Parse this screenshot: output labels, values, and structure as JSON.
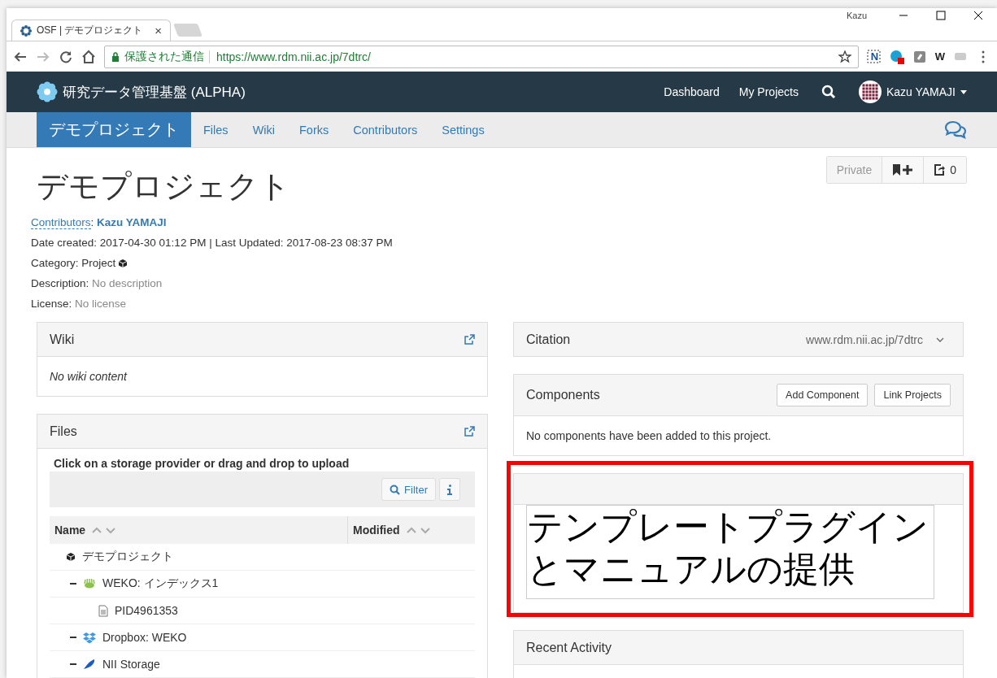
{
  "browser": {
    "tab": {
      "title": "OSF | デモプロジェクト",
      "close": "×"
    },
    "profile": "Kazu",
    "address": {
      "security": "保護された通信",
      "url": "https://www.rdm.nii.ac.jp/7dtrc/"
    },
    "extension_letter": "W",
    "note_extension_letter": "N"
  },
  "navbar": {
    "brand": "研究データ管理基盤 (ALPHA)",
    "links": [
      "Dashboard",
      "My Projects"
    ],
    "user": "Kazu YAMAJI"
  },
  "project_nav": {
    "title": "デモプロジェクト",
    "links": [
      "Files",
      "Wiki",
      "Forks",
      "Contributors",
      "Settings"
    ]
  },
  "project": {
    "title": "デモプロジェクト",
    "privacy": "Private",
    "fork_count": "0",
    "contributors": {
      "link": "Contributors",
      "text": ": **Kazu YAMAJI**"
    },
    "dates": "Date created: 2017-04-30 01:12 PM | Last Updated: 2017-08-23 08:37 PM",
    "category": {
      "label": "Category:",
      "value": "Project"
    },
    "description": {
      "label": "Description:",
      "value": "No description"
    },
    "license": {
      "label": "License:",
      "value": "No license"
    }
  },
  "wiki": {
    "title": "Wiki",
    "body": "No wiki content"
  },
  "files": {
    "title": "Files",
    "hint": "Click on a storage provider or drag and drop to upload",
    "filter": "Filter",
    "columns": [
      "Name",
      "Modified"
    ],
    "tree": [
      {
        "name": "デモプロジェクト",
        "kind": "project",
        "children": [
          {
            "name": "WEKO: インデックス1",
            "kind": "weko",
            "expanded": true,
            "children": [
              {
                "name": "PID4961353",
                "kind": "file"
              }
            ]
          },
          {
            "name": "Dropbox: WEKO",
            "kind": "dropbox",
            "expanded": true
          },
          {
            "name": "NII Storage",
            "kind": "storage",
            "expanded": true
          }
        ]
      }
    ]
  },
  "citation": {
    "title": "Citation",
    "url": "www.rdm.nii.ac.jp/7dtrc"
  },
  "components": {
    "title": "Components",
    "buttons": [
      "Add Component",
      "Link Projects"
    ],
    "body": "No components have been added to this project."
  },
  "template": {
    "text": "テンプレートプラグインとマニュアルの提供"
  },
  "recent_activity": {
    "title": "Recent Activity"
  }
}
